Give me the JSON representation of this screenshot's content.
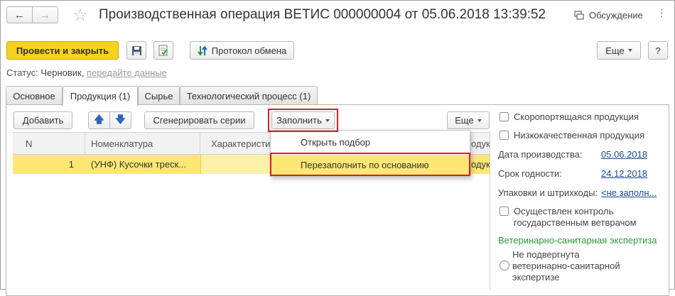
{
  "window": {
    "title": "Производственная операция ВЕТИС 000000004 от 05.06.2018 13:39:52",
    "discussion_label": "Обсуждение"
  },
  "toolbar": {
    "post_close_label": "Провести и закрыть",
    "exchange_log_label": "Протокол обмена",
    "more_label": "Еще",
    "help_label": "?"
  },
  "status": {
    "prefix": "Статус:",
    "value": "Черновик,",
    "link": "передайте данные"
  },
  "tabs": [
    {
      "label": "Основное"
    },
    {
      "label": "Продукция (1)"
    },
    {
      "label": "Сырье"
    },
    {
      "label": "Технологический процесс (1)"
    }
  ],
  "products": {
    "add_label": "Добавить",
    "generate_label": "Сгенерировать серии",
    "fill_label": "Заполнить",
    "more_label": "Еще",
    "columns": [
      "N",
      "Номенклатура",
      "Характеристи",
      "одукци"
    ],
    "rows": [
      {
        "n": "1",
        "nomenclature": "(УНФ) Кусочки треск...",
        "tail": "одук"
      }
    ],
    "fill_menu": [
      "Открыть подбор",
      "Перезаполнить по основанию"
    ]
  },
  "side": {
    "perishable_label": "Скоропортящаяся продукция",
    "low_quality_label": "Низкокачественная продукция",
    "production_date_label": "Дата производства:",
    "production_date": "05.06.2018",
    "expiry_label": "Срок годности:",
    "expiry_date": "24.12.2018",
    "packages_label": "Упаковки и штрихкоды:",
    "packages_value": "<не заполн...",
    "vet_control_line1": "Осуществлен контроль",
    "vet_control_line2": "государственным ветврачом",
    "expertise_header": "Ветеринарно-санитарная экспертиза",
    "not_subjected_line1": "Не подвергнута",
    "not_subjected_line2": "ветеринарно-санитарной",
    "not_subjected_line3": "экспертизе"
  },
  "colors": {
    "accent_yellow": "#f5d21f",
    "selected_row": "#fce774",
    "highlight_red": "#d0202a",
    "section_green": "#2a9a3a",
    "link_blue": "#1a4a8c"
  }
}
